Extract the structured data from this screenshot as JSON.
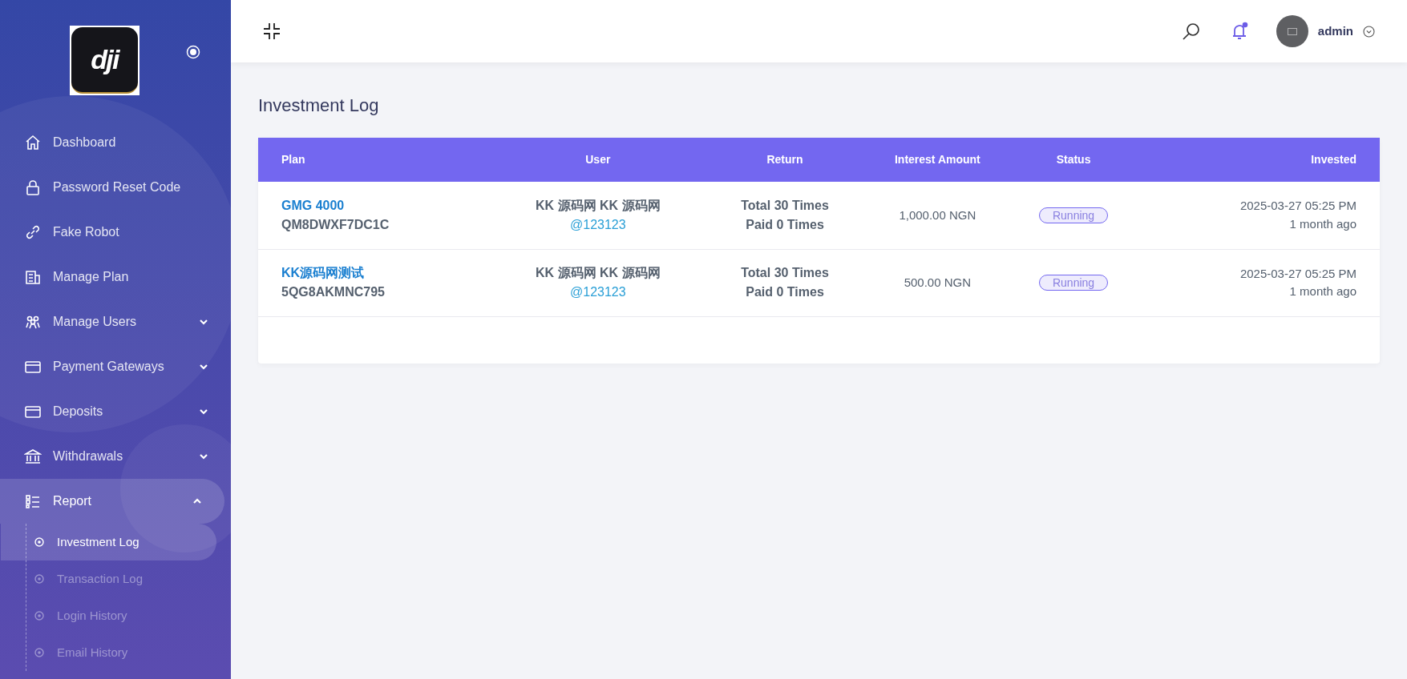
{
  "sidebar": {
    "logo_text": "dji",
    "items": [
      {
        "label": "Dashboard",
        "kind": "link",
        "selected": false
      },
      {
        "label": "Password Reset Code",
        "kind": "link",
        "selected": false
      },
      {
        "label": "Fake Robot",
        "kind": "link",
        "selected": false
      },
      {
        "label": "Manage Plan",
        "kind": "link",
        "selected": false
      },
      {
        "label": "Manage Users",
        "kind": "dropdown",
        "expanded": false,
        "selected": false
      },
      {
        "label": "Payment Gateways",
        "kind": "dropdown",
        "expanded": false,
        "selected": false
      },
      {
        "label": "Deposits",
        "kind": "dropdown",
        "expanded": false,
        "selected": false
      },
      {
        "label": "Withdrawals",
        "kind": "dropdown",
        "expanded": false,
        "selected": false
      },
      {
        "label": "Report",
        "kind": "dropdown",
        "expanded": true,
        "selected": true,
        "children": [
          {
            "label": "Investment Log",
            "selected": true
          },
          {
            "label": "Transaction Log",
            "selected": false
          },
          {
            "label": "Login History",
            "selected": false
          },
          {
            "label": "Email History",
            "selected": false
          }
        ]
      }
    ]
  },
  "header": {
    "user": "admin"
  },
  "page_title": "Investment Log",
  "table": {
    "columns": [
      "Plan",
      "User",
      "Return",
      "Interest Amount",
      "Status",
      "Invested"
    ],
    "rows": [
      {
        "plan_name": "GMG 4000",
        "plan_code": "QM8DWXF7DC1C",
        "user_name": "KK 源码网 KK 源码网",
        "username": "@123123",
        "return_total": "Total 30 Times",
        "return_paid": "Paid 0 Times",
        "interest": "1,000.00 NGN",
        "status": "Running",
        "invested_date": "2025-03-27 05:25 PM",
        "invested_ago": "1 month ago"
      },
      {
        "plan_name": "KK源码网测试",
        "plan_code": "5QG8AKMNC795",
        "user_name": "KK 源码网 KK 源码网",
        "username": "@123123",
        "return_total": "Total 30 Times",
        "return_paid": "Paid 0 Times",
        "interest": "500.00 NGN",
        "status": "Running",
        "invested_date": "2025-03-27 05:25 PM",
        "invested_ago": "1 month ago"
      }
    ]
  }
}
